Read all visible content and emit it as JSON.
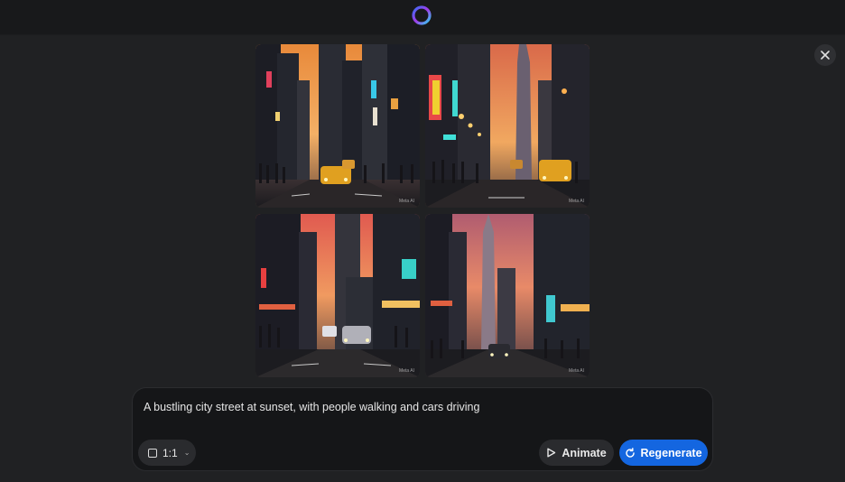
{
  "app": {
    "logo_icon": "ring-logo-icon",
    "accent_color": "#1466e0"
  },
  "images": [
    {
      "alt": "city-street-sunset-1",
      "watermark": "Meta AI"
    },
    {
      "alt": "city-street-sunset-2",
      "watermark": "Meta AI"
    },
    {
      "alt": "city-street-sunset-3",
      "watermark": "Meta AI"
    },
    {
      "alt": "city-street-sunset-4",
      "watermark": "Meta AI"
    }
  ],
  "prompt": {
    "text": "A bustling city street at sunset, with people walking and cars driving"
  },
  "controls": {
    "aspect_ratio_label": "1:1",
    "animate_label": "Animate",
    "regenerate_label": "Regenerate"
  }
}
